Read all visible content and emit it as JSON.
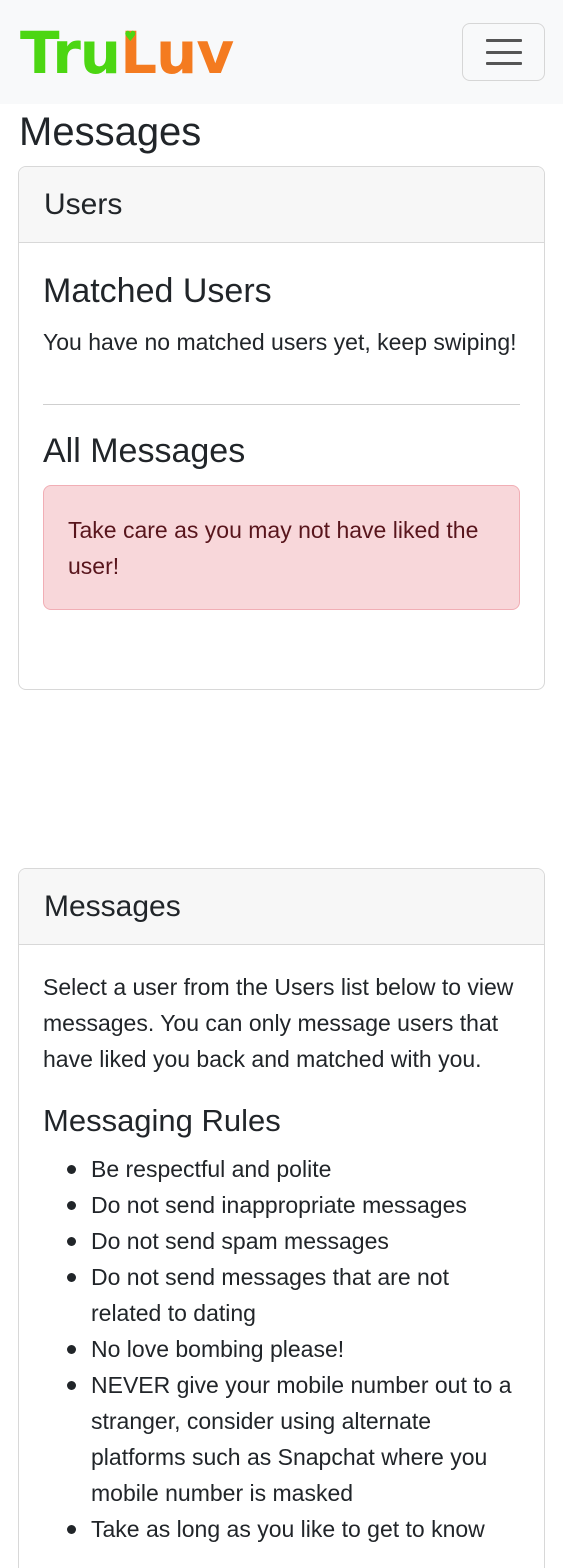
{
  "navbar": {
    "brand_part1": "Tru",
    "brand_part2": "Luv",
    "brand_colors": {
      "tru": "#4cd612",
      "luv": "#f47b20"
    },
    "menu_icon": "hamburger-icon"
  },
  "page": {
    "title": "Messages"
  },
  "users_card": {
    "header": "Users",
    "matched_title": "Matched Users",
    "matched_empty": "You have no matched users yet, keep swiping!",
    "all_messages_title": "All Messages",
    "alert_text": "Take care as you may not have liked the user!",
    "alert_color": "#f8d7da"
  },
  "messages_card": {
    "header": "Messages",
    "intro": "Select a user from the Users list below to view messages. You can only message users that have liked you back and matched with you.",
    "rules_title": "Messaging Rules",
    "rules": [
      "Be respectful and polite",
      "Do not send inappropriate messages",
      "Do not send spam messages",
      "Do not send messages that are not related to dating",
      "No love bombing please!",
      "NEVER give your mobile number out to a stranger, consider using alternate platforms such as Snapchat where you mobile number is masked",
      "Take as long as you like to get to know"
    ]
  }
}
